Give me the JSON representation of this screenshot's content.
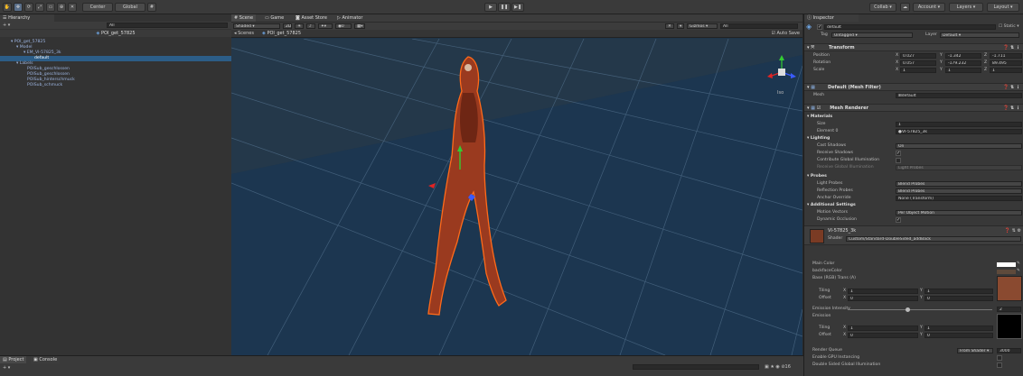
{
  "toolbar": {
    "center_label": "Center",
    "global_label": "Global",
    "collab_label": "Collab ▾",
    "account_label": "Account ▾",
    "layers_label": "Layers ▾",
    "layout_label": "Layout ▾"
  },
  "hierarchy": {
    "tab": "Hierarchy",
    "add_label": "+ ▾",
    "search_placeholder": "All",
    "scene_name": "POI_get_57825",
    "rows": [
      "POI_get_57825",
      "Model",
      "EM_VI-57825_3k",
      "default",
      "Labels",
      "POISub_geschlossen",
      "POISub_geschlossen",
      "POISub_hinterschmuck",
      "POISub_schmuck"
    ]
  },
  "scene": {
    "tabs": [
      "Scene",
      "Game",
      "Asset Store",
      "Animator"
    ],
    "shading": "Shaded",
    "mode_2d": "2D",
    "gizmos": "Gizmos ▾",
    "search_placeholder": "All",
    "breadcrumb_root": "Scenes",
    "breadcrumb_current": "POI_get_57825",
    "auto_save": "Auto Save",
    "persp_label": "Iso"
  },
  "inspector": {
    "tab": "Inspector",
    "object_name": "default",
    "static_label": "Static ▾",
    "tag_label": "Tag",
    "tag_value": "Untagged",
    "layer_label": "Layer",
    "layer_value": "Default",
    "transform": {
      "title": "Transform",
      "position_label": "Position",
      "position": [
        "0.027",
        "-1.342",
        "-1.711"
      ],
      "rotation_label": "Rotation",
      "rotation": [
        "0.057",
        "-179.232",
        "89.495"
      ],
      "scale_label": "Scale",
      "scale": [
        "1",
        "1",
        "1"
      ]
    },
    "mesh_filter": {
      "title": "Default (Mesh Filter)",
      "mesh_label": "Mesh",
      "mesh_value": "default"
    },
    "mesh_renderer": {
      "title": "Mesh Renderer",
      "materials": "Materials",
      "size_label": "Size",
      "size_value": "1",
      "element_label": "Element 0",
      "element_value": "VI-57825_3k",
      "lighting": "Lighting",
      "cast_shadows_label": "Cast Shadows",
      "cast_shadows_value": "On",
      "receive_shadows_label": "Receive Shadows",
      "contribute_gi_label": "Contribute Global Illumination",
      "receive_gi_label": "Receive Global Illumination",
      "receive_gi_value": "Light Probes",
      "probes": "Probes",
      "light_probes_label": "Light Probes",
      "light_probes_value": "Blend Probes",
      "reflection_probes_label": "Reflection Probes",
      "reflection_probes_value": "Blend Probes",
      "anchor_label": "Anchor Override",
      "anchor_value": "None (Transform)",
      "additional": "Additional Settings",
      "motion_label": "Motion Vectors",
      "motion_value": "Per Object Motion",
      "dynamic_label": "Dynamic Occlusion"
    },
    "material": {
      "name": "VI-57825_3k",
      "shader_label": "Shader",
      "shader_value": "Custom/Standard-DoubleSided_addBack",
      "main_color": "Main Color",
      "backface_color": "backfaceColor",
      "base_label": "Base (RGB) Trans (A)",
      "tiling_label": "Tiling",
      "offset_label": "Offset",
      "tiling": [
        "1",
        "1"
      ],
      "offset": [
        "0",
        "0"
      ],
      "emission_intensity_label": "Emission Intensity",
      "emission_intensity_value": "2",
      "emission_label": "Emission",
      "tiling2": [
        "1",
        "1"
      ],
      "offset2": [
        "0",
        "0"
      ],
      "render_queue_label": "Render Queue",
      "render_queue_mode": "From Shader ▾",
      "render_queue_value": "3000",
      "gpu_label": "Enable GPU Instancing",
      "dsgi_label": "Double Sided Global Illumination"
    }
  },
  "bottom": {
    "project_tab": "Project",
    "console_tab": "Console",
    "search_placeholder": ""
  },
  "colors": {
    "accent": "#2c5d87",
    "outline": "#ff6a1a",
    "scene_bg": "#1f3549"
  }
}
